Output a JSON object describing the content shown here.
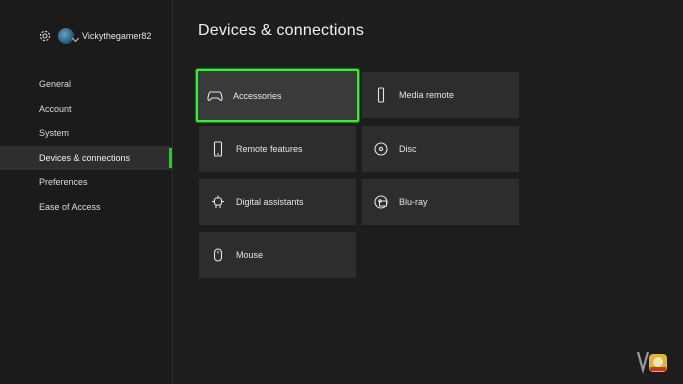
{
  "profile": {
    "username": "Vickythegamer82"
  },
  "sidebar": {
    "items": [
      {
        "label": "General"
      },
      {
        "label": "Account"
      },
      {
        "label": "System"
      },
      {
        "label": "Devices & connections"
      },
      {
        "label": "Preferences"
      },
      {
        "label": "Ease of Access"
      }
    ],
    "active_index": 3
  },
  "main": {
    "title": "Devices & connections",
    "tiles": [
      {
        "label": "Accessories",
        "icon": "gamepad-icon",
        "focused": true
      },
      {
        "label": "Media remote",
        "icon": "media-remote-icon"
      },
      {
        "label": "Remote features",
        "icon": "phone-icon"
      },
      {
        "label": "Disc",
        "icon": "disc-icon"
      },
      {
        "label": "Digital assistants",
        "icon": "assistant-icon"
      },
      {
        "label": "Blu-ray",
        "icon": "bluray-icon"
      },
      {
        "label": "Mouse",
        "icon": "mouse-icon"
      }
    ]
  },
  "colors": {
    "accent": "#3ee63e",
    "background": "#1d1d1d",
    "tile": "#2d2d2d"
  }
}
